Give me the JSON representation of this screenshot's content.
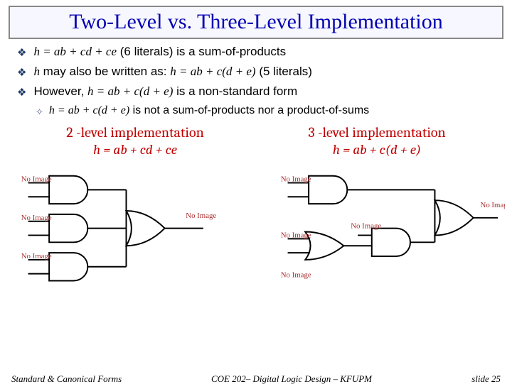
{
  "title": "Two-Level vs. Three-Level Implementation",
  "bullets": {
    "b1_pre": "",
    "b1_math": "h = ab + cd + ce",
    "b1_post": " (6 literals) is a sum-of-products",
    "b2_pre": "",
    "b2_math_pre": "h",
    "b2_text_mid": " may also be written as: ",
    "b2_math": "h = ab + c(d + e)",
    "b2_post": " (5 literals)",
    "b3_pre": "However, ",
    "b3_math": "h = ab + c(d + e)",
    "b3_post": " is a non-standard form",
    "s1_math": "h = ab + c(d + e)",
    "s1_post": " is not a sum-of-products nor a product-of-sums"
  },
  "impl_left": {
    "title": "2 -level implementation",
    "eq": "h = ab + cd + ce"
  },
  "impl_right": {
    "title": "3 -level implementation",
    "eq": "h = ab + c(d + e)"
  },
  "noimg": "No Image",
  "footer": {
    "left": "Standard & Canonical Forms",
    "mid": "COE 202– Digital Logic Design – KFUPM",
    "right": "slide 25"
  }
}
